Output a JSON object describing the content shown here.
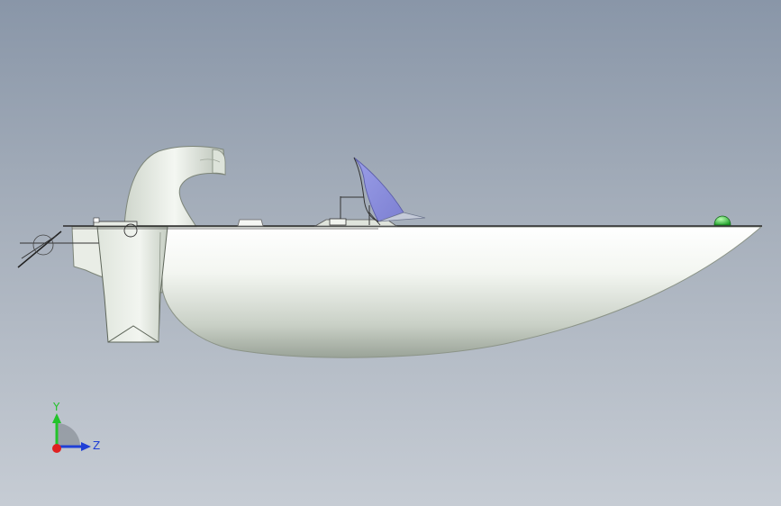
{
  "viewport": {
    "background_top": "#8996a8",
    "background_bottom": "#c6ccd4"
  },
  "model": {
    "hull_color": "#eef2ec",
    "windshield_color": "#8c8ede",
    "nav_light_color": "#2ecc40"
  },
  "triad": {
    "y_label": "Y",
    "z_label": "Z",
    "y_color": "#22c32a",
    "z_color": "#1f3fd6",
    "x_color": "#e02020",
    "icons": [
      "y-axis-arrow-icon",
      "z-axis-arrow-icon",
      "x-axis-origin-icon"
    ]
  }
}
